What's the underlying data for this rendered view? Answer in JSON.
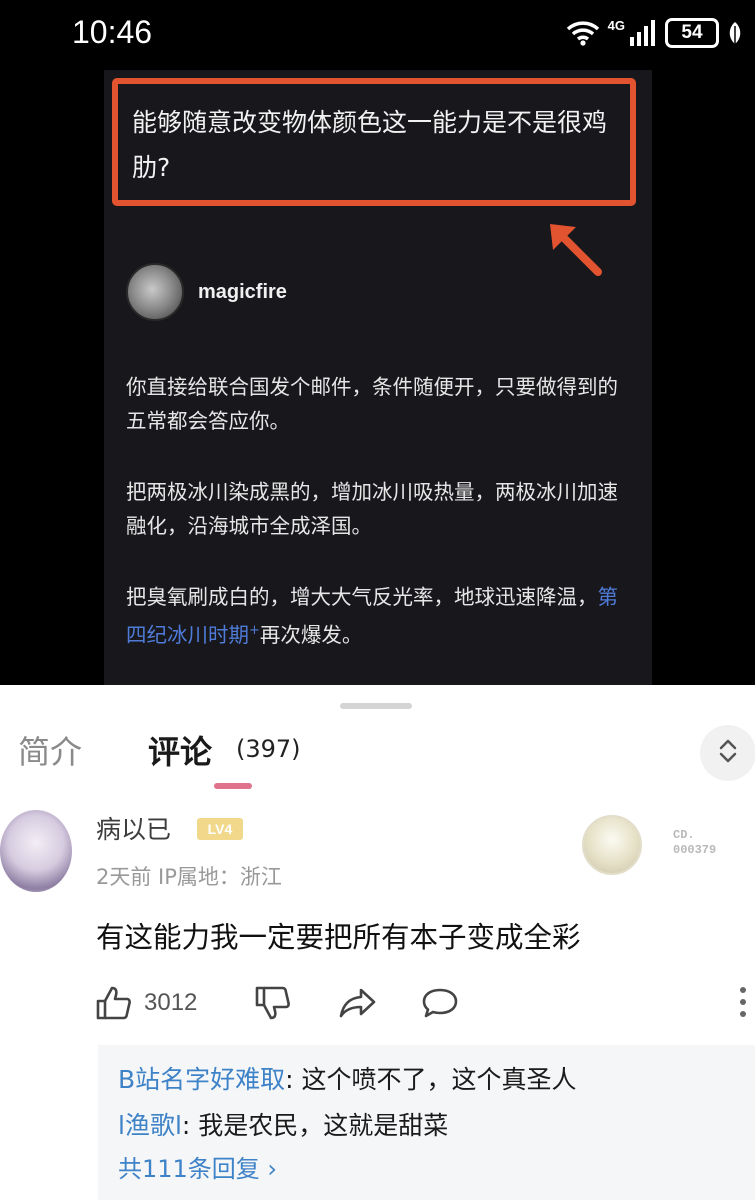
{
  "status_bar": {
    "time": "10:46",
    "network": "4G",
    "battery": "54"
  },
  "post": {
    "question": "能够随意改变物体颜色这一能力是不是很鸡肋?",
    "author": "magicfire",
    "paragraphs": [
      "你直接给联合国发个邮件，条件随便开，只要做得到的五常都会答应你。",
      "把两极冰川染成黑的，增加冰川吸热量，两极冰川加速融化，沿海城市全成泽国。"
    ],
    "paragraph3": {
      "before": "把臭氧刷成白的，增大大气反光率，地球迅速降温，",
      "link": "第四纪冰川时期",
      "link_mark": "+",
      "after": "再次爆发。"
    }
  },
  "tabs": {
    "intro": "简介",
    "comments": "评论",
    "comment_count": "(397)"
  },
  "comment": {
    "username": "病以已",
    "level": "LV4",
    "meta": "2天前  IP属地：浙江",
    "fan_badge": [
      "CD.",
      "000379"
    ],
    "text": "有这能力我一定要把所有本子变成全彩",
    "likes": "3012"
  },
  "replies": [
    {
      "user": "B站名字好难取",
      "text": ": 这个喷不了，这个真圣人"
    },
    {
      "user": "l渔歌l",
      "text": ": 我是农民，这就是甜菜"
    }
  ],
  "reply_total": "共111条回复 ›",
  "colors": {
    "highlight_border": "#e2532f",
    "link_blue": "#3e82c7",
    "tab_underline": "#e0728b"
  }
}
